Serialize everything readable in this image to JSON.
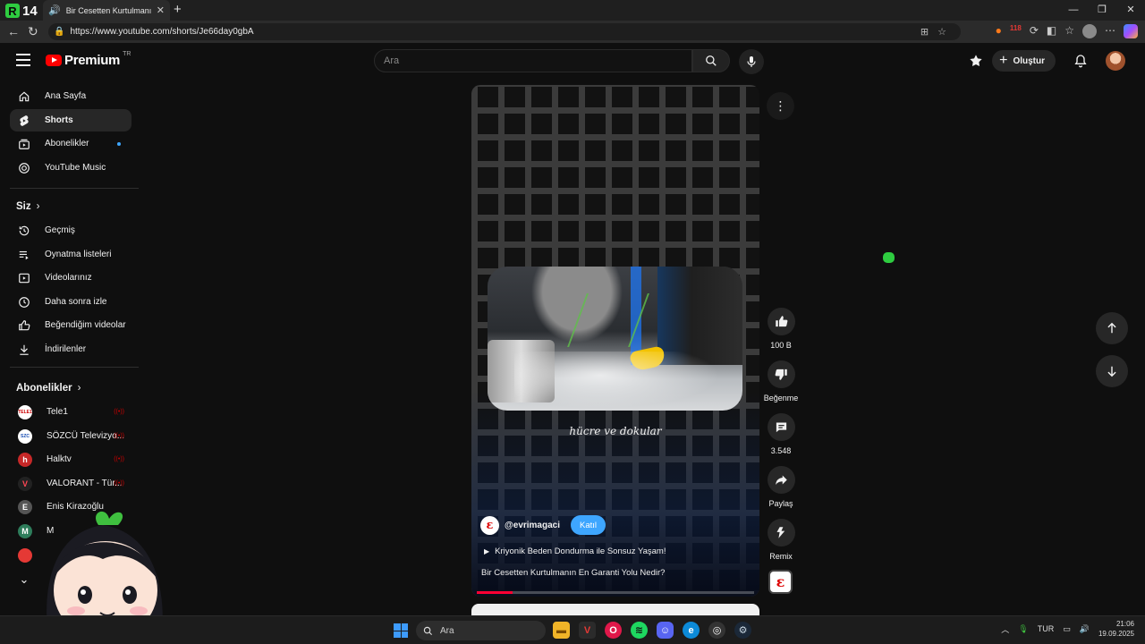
{
  "browser": {
    "tab_title": "Bir Cesetten Kurtulmanın En...",
    "url": "https://www.youtube.com/shorts/Je66day0gbA",
    "extension_badge": "118",
    "app_badge": "14"
  },
  "header": {
    "logo_text": "Premium",
    "country_code": "TR",
    "search_placeholder": "Ara",
    "create_label": "Oluştur"
  },
  "sidebar": {
    "main_items": [
      {
        "label": "Ana Sayfa",
        "icon": "home-icon"
      },
      {
        "label": "Shorts",
        "icon": "shorts-icon",
        "active": true
      },
      {
        "label": "Abonelikler",
        "icon": "subscriptions-icon"
      },
      {
        "label": "YouTube Music",
        "icon": "music-icon"
      }
    ],
    "you_heading": "Siz",
    "you_items": [
      {
        "label": "Geçmiş",
        "icon": "history-icon"
      },
      {
        "label": "Oynatma listeleri",
        "icon": "playlist-icon"
      },
      {
        "label": "Videolarınız",
        "icon": "your-videos-icon"
      },
      {
        "label": "Daha sonra izle",
        "icon": "watch-later-icon"
      },
      {
        "label": "Beğendiğim videolar",
        "icon": "liked-icon"
      },
      {
        "label": "İndirilenler",
        "icon": "download-icon"
      }
    ],
    "subs_heading": "Abonelikler",
    "channels": [
      {
        "label": "Tele1",
        "avatar": "TELE1",
        "color": "#ffffff"
      },
      {
        "label": "SÖZCÜ Televizyo...",
        "avatar": "SZC",
        "color": "#ffffff"
      },
      {
        "label": "Halktv",
        "avatar": "h",
        "color": "#c62828"
      },
      {
        "label": "VALORANT - Tür...",
        "avatar": "V",
        "color": "#222222"
      },
      {
        "label": "Enis Kirazoğlu",
        "avatar": "E",
        "color": "#555555"
      },
      {
        "label": "M",
        "avatar": "M",
        "color": "#2e7d5b"
      },
      {
        "label": "",
        "avatar": "",
        "color": "#e53935"
      }
    ]
  },
  "short": {
    "caption": "hücre ve dokular",
    "channel_handle": "@evrimagaci",
    "join_label": "Katıl",
    "playlist_title": "Kriyonik Beden Dondurma ile Sonsuz Yaşam!",
    "video_title": "Bir Cesetten Kurtulmanın En Garanti Yolu Nedir?",
    "progress": 0.13
  },
  "actions": {
    "like_count": "100 B",
    "dislike_label": "Beğenme",
    "comment_count": "3.548",
    "share_label": "Paylaş",
    "remix_label": "Remix"
  },
  "taskbar": {
    "search_placeholder": "Ara",
    "lang": "TUR",
    "time": "21:06",
    "date": "19.09.2025"
  },
  "colors": {
    "accent_blue": "#3ea6ff",
    "yt_red": "#ff0000",
    "background": "#0f0f0f"
  }
}
